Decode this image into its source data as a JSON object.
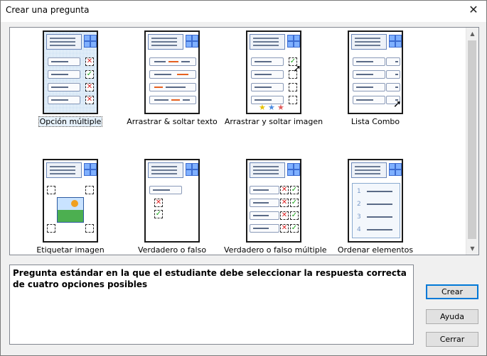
{
  "window": {
    "title": "Crear una pregunta",
    "close_icon": "close-icon"
  },
  "gallery": {
    "items": [
      {
        "id": "opcion-multiple",
        "label": "Opción múltiple",
        "selected": true
      },
      {
        "id": "arrastrar-texto",
        "label": "Arrastrar & soltar texto",
        "selected": false
      },
      {
        "id": "arrastrar-imagen",
        "label": "Arrastrar y soltar imagen",
        "selected": false
      },
      {
        "id": "lista-combo",
        "label": "Lista Combo",
        "selected": false
      },
      {
        "id": "etiquetar-imagen",
        "label": "Etiquetar imagen",
        "selected": false
      },
      {
        "id": "verdadero-falso",
        "label": "Verdadero o falso",
        "selected": false
      },
      {
        "id": "verdadero-falso-multiple",
        "label": "Verdadero o falso múltiple",
        "selected": false
      },
      {
        "id": "ordenar-elementos",
        "label": "Ordenar elementos",
        "selected": false
      }
    ]
  },
  "description": "Pregunta estándar en la que el estudiante debe seleccionar la respuesta correcta de cuatro opciones posibles",
  "buttons": {
    "create": "Crear",
    "help": "Ayuda",
    "close": "Cerrar"
  },
  "colors": {
    "selection": "#bdd8f0",
    "accent": "#0078d7",
    "wrong": "#dd2222",
    "correct": "#1aa31a"
  }
}
